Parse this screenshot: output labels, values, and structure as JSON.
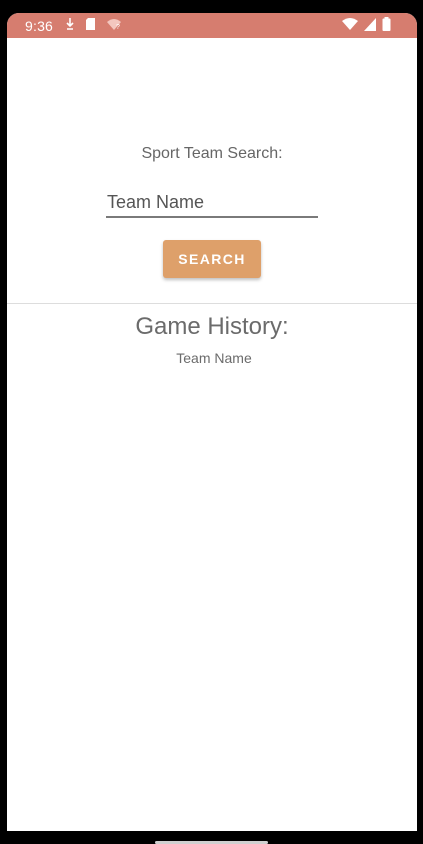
{
  "status_bar": {
    "time": "9:36",
    "background": "#d67d6f",
    "left_icons": [
      "download-icon",
      "sd-card-icon",
      "wifi-question-icon"
    ],
    "right_icons": [
      "wifi-icon",
      "signal-icon",
      "battery-icon"
    ]
  },
  "search": {
    "label": "Sport Team Search:",
    "input_placeholder": "Team Name",
    "input_value": "",
    "button_label": "SEARCH",
    "button_color": "#dea06a"
  },
  "history": {
    "title": "Game History:",
    "team_name": "Team Name"
  }
}
